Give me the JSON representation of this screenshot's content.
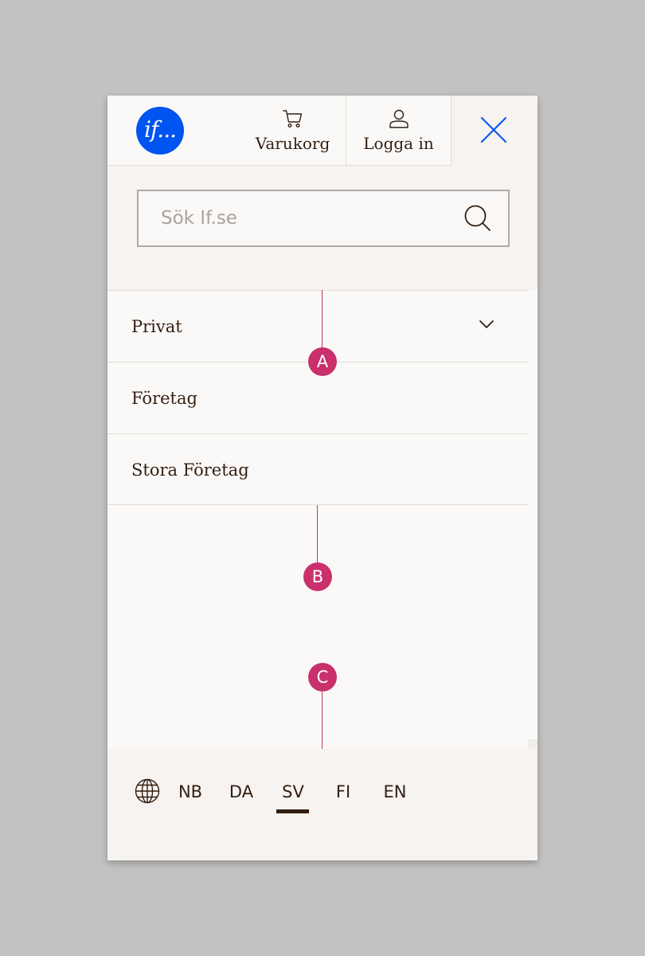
{
  "header": {
    "logo_text": "if...",
    "cart_label": "Varukorg",
    "login_label": "Logga in"
  },
  "search": {
    "placeholder": "Sök If.se"
  },
  "nav": {
    "items": [
      {
        "label": "Privat",
        "has_submenu": true
      },
      {
        "label": "Företag",
        "has_submenu": false
      },
      {
        "label": "Stora Företag",
        "has_submenu": false
      }
    ]
  },
  "footer": {
    "languages": [
      "NB",
      "DA",
      "SV",
      "FI",
      "EN"
    ],
    "active_language": "SV"
  },
  "annotations": [
    "A",
    "B",
    "C"
  ],
  "colors": {
    "brand_blue": "#0054f0",
    "text_brown": "#331e11",
    "annotation_pink": "#c9306c",
    "panel_beige": "#f6f3f0",
    "surface": "#faf9f7"
  }
}
